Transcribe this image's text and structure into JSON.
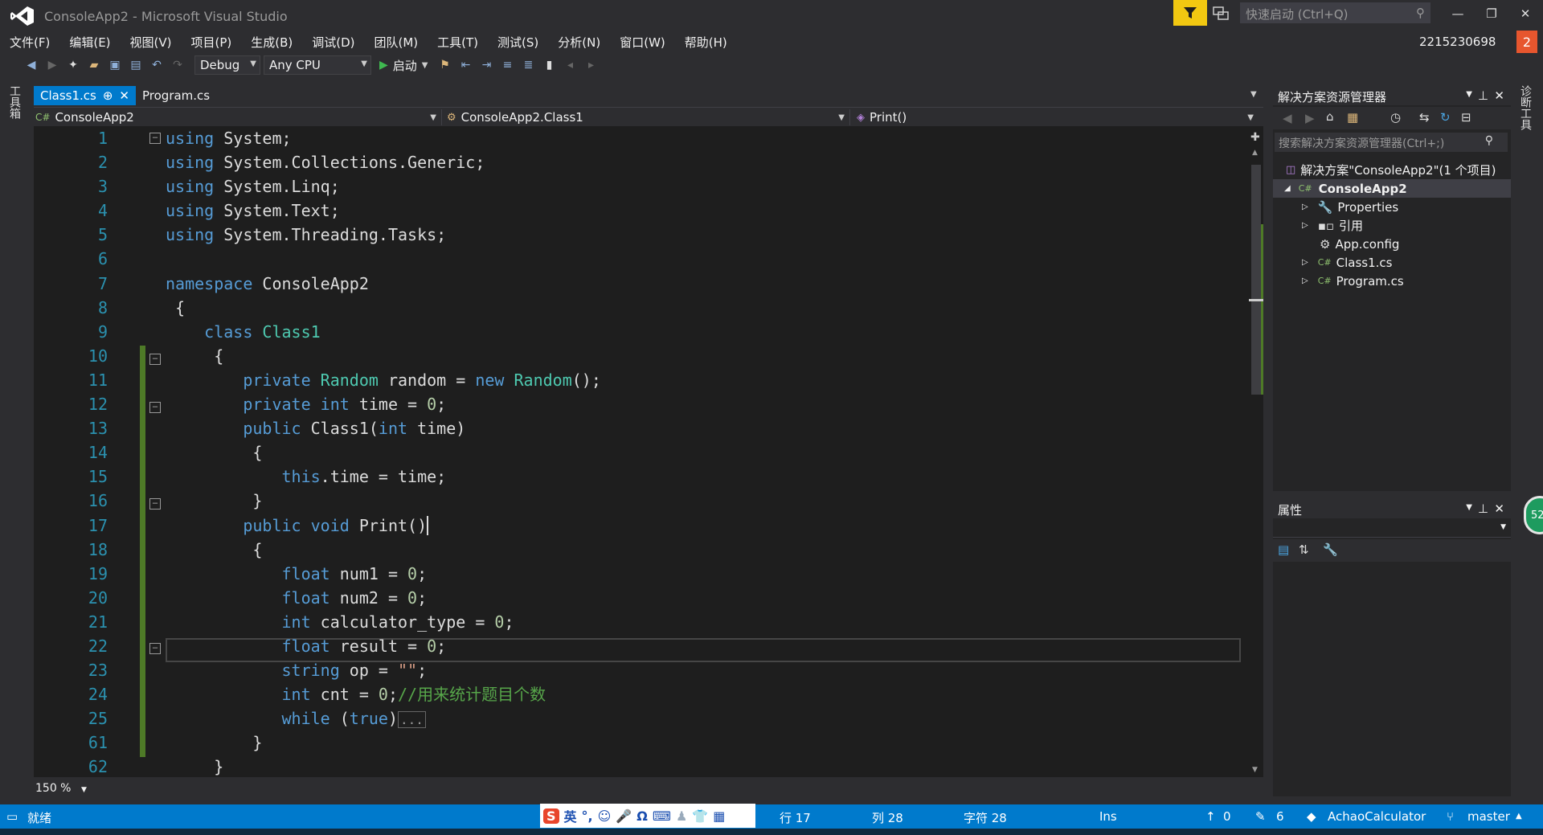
{
  "window": {
    "title": "ConsoleApp2 - Microsoft Visual Studio",
    "quick_launch": "快速启动 (Ctrl+Q)",
    "user": "2215230698",
    "notifications": "2"
  },
  "menu": [
    "文件(F)",
    "编辑(E)",
    "视图(V)",
    "项目(P)",
    "生成(B)",
    "调试(D)",
    "团队(M)",
    "工具(T)",
    "测试(S)",
    "分析(N)",
    "窗口(W)",
    "帮助(H)"
  ],
  "toolbar": {
    "config": "Debug",
    "platform": "Any CPU",
    "start": "启动"
  },
  "left_strip": {
    "label": "工具箱"
  },
  "right_strip": {
    "label": "诊断工具"
  },
  "tabs": [
    {
      "label": "Class1.cs",
      "pin": "⊕",
      "close": "✕"
    },
    {
      "label": "Program.cs"
    }
  ],
  "nav": {
    "project": "ConsoleApp2",
    "class": "ConsoleApp2.Class1",
    "member": "Print()"
  },
  "line_numbers": [
    "1",
    "2",
    "3",
    "4",
    "5",
    "6",
    "7",
    "8",
    "9",
    "10",
    "11",
    "12",
    "13",
    "14",
    "15",
    "16",
    "17",
    "18",
    "19",
    "20",
    "21",
    "22",
    "23",
    "24",
    "25",
    "61",
    "62"
  ],
  "code": {
    "l1a": "using",
    "l1b": " System;",
    "l2a": "using",
    "l2b": " System.Collections.Generic;",
    "l3a": "using",
    "l3b": " System.Linq;",
    "l4a": "using",
    "l4b": " System.Text;",
    "l5a": "using",
    "l5b": " System.Threading.Tasks;",
    "l7a": "namespace",
    "l7b": " ConsoleApp2",
    "l8": " {",
    "l9a": "    class",
    "l9b": " Class1",
    "l10": "     {",
    "l11a": "        private",
    "l11b": "Random",
    "l11c": " random = ",
    "l11d": "new",
    "l11e": "Random",
    "l11f": "();",
    "l12a": "        private",
    "l12b": "int",
    "l12c": " time = ",
    "l12d": "0",
    "l12e": ";",
    "l13a": "        public",
    "l13b": " Class1(",
    "l13c": "int",
    "l13d": " time)",
    "l14": "         {",
    "l15a": "            this",
    "l15b": ".time = time;",
    "l16": "         }",
    "l17a": "        public",
    "l17b": "void",
    "l17c": " Print()",
    "l18": "         {",
    "l19a": "            float",
    "l19b": " num1 = ",
    "l19c": "0",
    "l19d": ";",
    "l20a": "            float",
    "l20b": " num2 = ",
    "l20c": "0",
    "l20d": ";",
    "l21a": "            int",
    "l21b": " calculator_type = ",
    "l21c": "0",
    "l21d": ";",
    "l22a": "            float",
    "l22b": " result = ",
    "l22c": "0",
    "l22d": ";",
    "l23a": "            string",
    "l23b": " op = ",
    "l23c": "\"\"",
    "l23d": ";",
    "l24a": "            int",
    "l24b": " cnt = ",
    "l24c": "0",
    "l24d": ";",
    "l24e": "//用来统计题目个数",
    "l25a": "            while",
    "l25b": " (",
    "l25c": "true",
    "l25d": ")",
    "l25e": "...",
    "l61": "         }",
    "l62": "     }"
  },
  "zoom": "150 %",
  "solution_explorer": {
    "title": "解决方案资源管理器",
    "search": "搜索解决方案资源管理器(Ctrl+;)",
    "solution": "解决方案\"ConsoleApp2\"(1 个项目)",
    "project": "ConsoleApp2",
    "items": [
      "Properties",
      "引用",
      "App.config",
      "Class1.cs",
      "Program.cs"
    ]
  },
  "properties": {
    "title": "属性"
  },
  "diag_badge": "52",
  "status": {
    "ready": "就绪",
    "row": "行 17",
    "col": "列 28",
    "char": "字符 28",
    "ins": "Ins",
    "up": "0",
    "edits": "6",
    "repo": "AchaoCalculator",
    "branch": "master"
  },
  "ime": {
    "lang": "英"
  }
}
